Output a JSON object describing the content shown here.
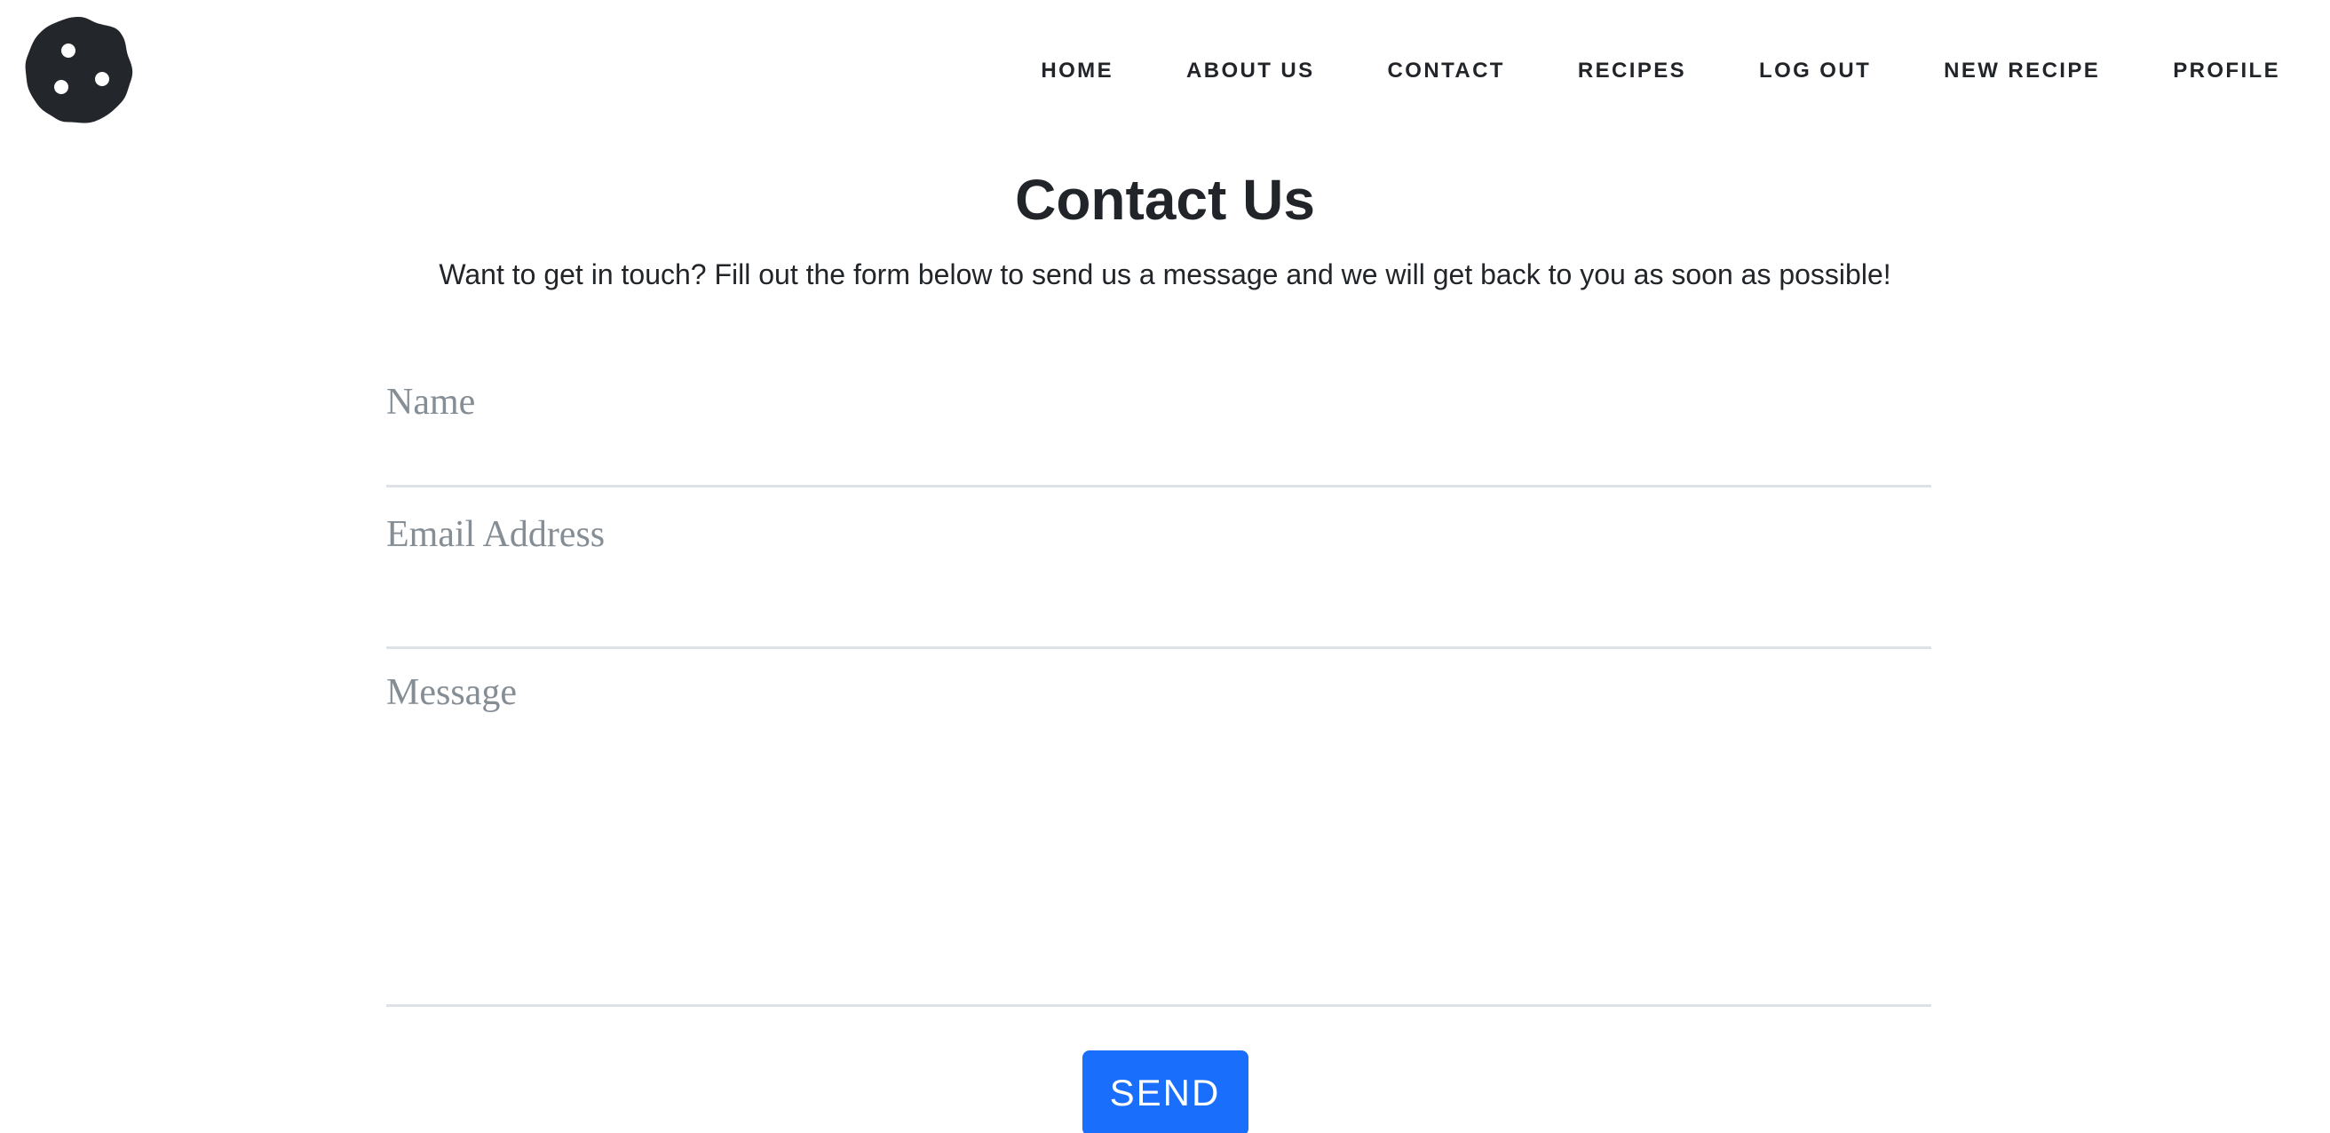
{
  "header": {
    "logo_icon": "cookie-icon",
    "nav": [
      {
        "label": "HOME"
      },
      {
        "label": "ABOUT US"
      },
      {
        "label": "CONTACT"
      },
      {
        "label": "RECIPES"
      },
      {
        "label": "LOG OUT"
      },
      {
        "label": "NEW RECIPE"
      },
      {
        "label": "PROFILE"
      }
    ]
  },
  "main": {
    "title": "Contact Us",
    "subtitle": "Want to get in touch? Fill out the form below to send us a message and we will get back to you as soon as possible!"
  },
  "form": {
    "name_placeholder": "Name",
    "name_value": "",
    "email_placeholder": "Email Address",
    "email_value": "",
    "message_placeholder": "Message",
    "message_value": "",
    "send_label": "SEND"
  },
  "colors": {
    "accent": "#1a6efc",
    "text": "#212529",
    "placeholder": "#858d95",
    "divider": "#dee2e6"
  }
}
